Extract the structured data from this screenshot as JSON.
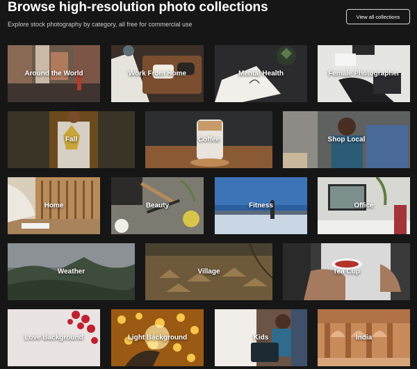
{
  "header": {
    "title": "Browse high-resolution photo collections",
    "subtitle": "Explore stock photography by category, all free for commercial use",
    "view_all_label": "View all collections"
  },
  "collections": [
    {
      "label": "Around the World"
    },
    {
      "label": "Work From Home"
    },
    {
      "label": "Mental Health"
    },
    {
      "label": "Female Photographer"
    },
    {
      "label": "Fall"
    },
    {
      "label": "Coffee"
    },
    {
      "label": "Shop Local"
    },
    {
      "label": "Home"
    },
    {
      "label": "Beauty"
    },
    {
      "label": "Fitness"
    },
    {
      "label": "Office"
    },
    {
      "label": "Weather"
    },
    {
      "label": "Village"
    },
    {
      "label": "Tea Cup"
    },
    {
      "label": "Love Background"
    },
    {
      "label": "Light Background"
    },
    {
      "label": "Kids"
    },
    {
      "label": "India"
    }
  ],
  "colors": {
    "page_background": "#161616",
    "text": "#ffffff"
  }
}
